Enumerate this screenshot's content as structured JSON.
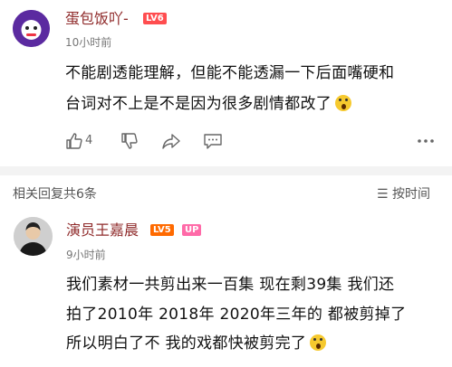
{
  "comment_main": {
    "username": "蛋包饭吖-",
    "level_badge": "LV6",
    "time": "10小时前",
    "text_line1": "不能剧透能理解，但能不能透漏一下后面嘴硬和",
    "text_line2": "台词对不上是不是因为很多剧情都改了",
    "emoji_name": "shocked-emoji",
    "like_count": "4",
    "icons": {
      "like": "thumb-up-icon",
      "dislike": "thumb-down-icon",
      "share": "share-icon",
      "reply": "comment-icon",
      "more": "more-icon"
    }
  },
  "replies_section": {
    "header": "相关回复共6条",
    "sort_label": "按时间"
  },
  "reply": {
    "username": "演员王嘉晨",
    "level_badge": "LV5",
    "up_badge": "UP",
    "time": "9小时前",
    "text_line1": "我们素材一共剪出来一百集 现在剩39集 我们还",
    "text_line2": "拍了2010年 2018年 2020年三年的 都被剪掉了",
    "text_line3": "所以明白了不 我的戏都快被剪完了",
    "emoji_name": "crying-shocked-emoji"
  },
  "colors": {
    "username": "#8f2a2a",
    "secondary_text": "#777777",
    "divider": "#f3f3f3"
  }
}
